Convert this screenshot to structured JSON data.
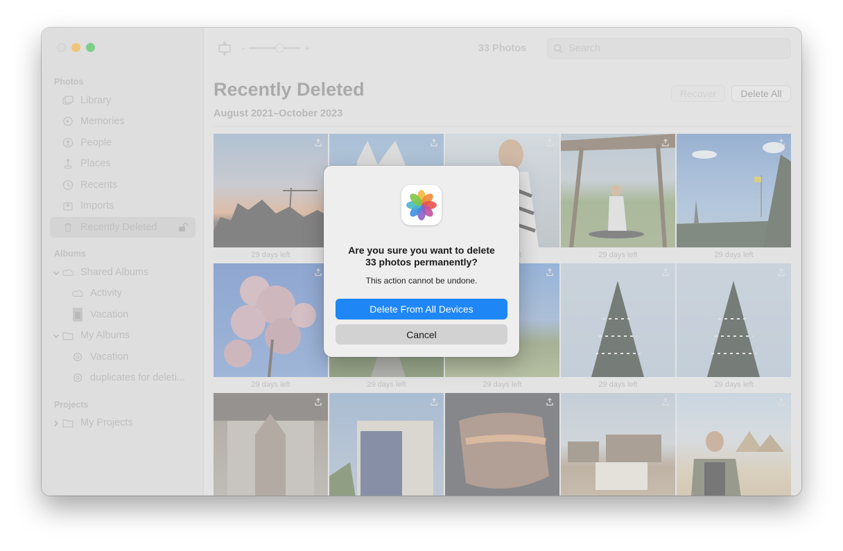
{
  "sidebar": {
    "photos_header": "Photos",
    "items": [
      {
        "label": "Library",
        "icon": "library-icon"
      },
      {
        "label": "Memories",
        "icon": "memories-icon"
      },
      {
        "label": "People",
        "icon": "people-icon"
      },
      {
        "label": "Places",
        "icon": "places-icon"
      },
      {
        "label": "Recents",
        "icon": "recents-icon"
      },
      {
        "label": "Imports",
        "icon": "imports-icon"
      },
      {
        "label": "Recently Deleted",
        "icon": "trash-icon"
      }
    ],
    "albums_header": "Albums",
    "shared_albums": "Shared Albums",
    "activity": "Activity",
    "shared_vacation": "Vacation",
    "my_albums": "My Albums",
    "my_vacation": "Vacation",
    "duplicates": "duplicates for deleti...",
    "projects_header": "Projects",
    "my_projects": "My Projects"
  },
  "toolbar": {
    "zoom_minus": "-",
    "zoom_plus": "+",
    "count": "33 Photos",
    "search_placeholder": "Search"
  },
  "main": {
    "title": "Recently Deleted",
    "subtitle": "August 2021–October 2023",
    "recover_label": "Recover",
    "delete_all_label": "Delete All",
    "caption": "29 days left"
  },
  "dialog": {
    "title_line1": "Are you sure you want to delete",
    "title_line2": "33 photos permanently?",
    "message": "This action cannot be undone.",
    "primary_label": "Delete From All Devices",
    "cancel_label": "Cancel"
  },
  "colors": {
    "accent": "#1f86f5",
    "close": "#d7d7d7",
    "minimize": "#f7b22a",
    "zoom": "#2ac240"
  }
}
